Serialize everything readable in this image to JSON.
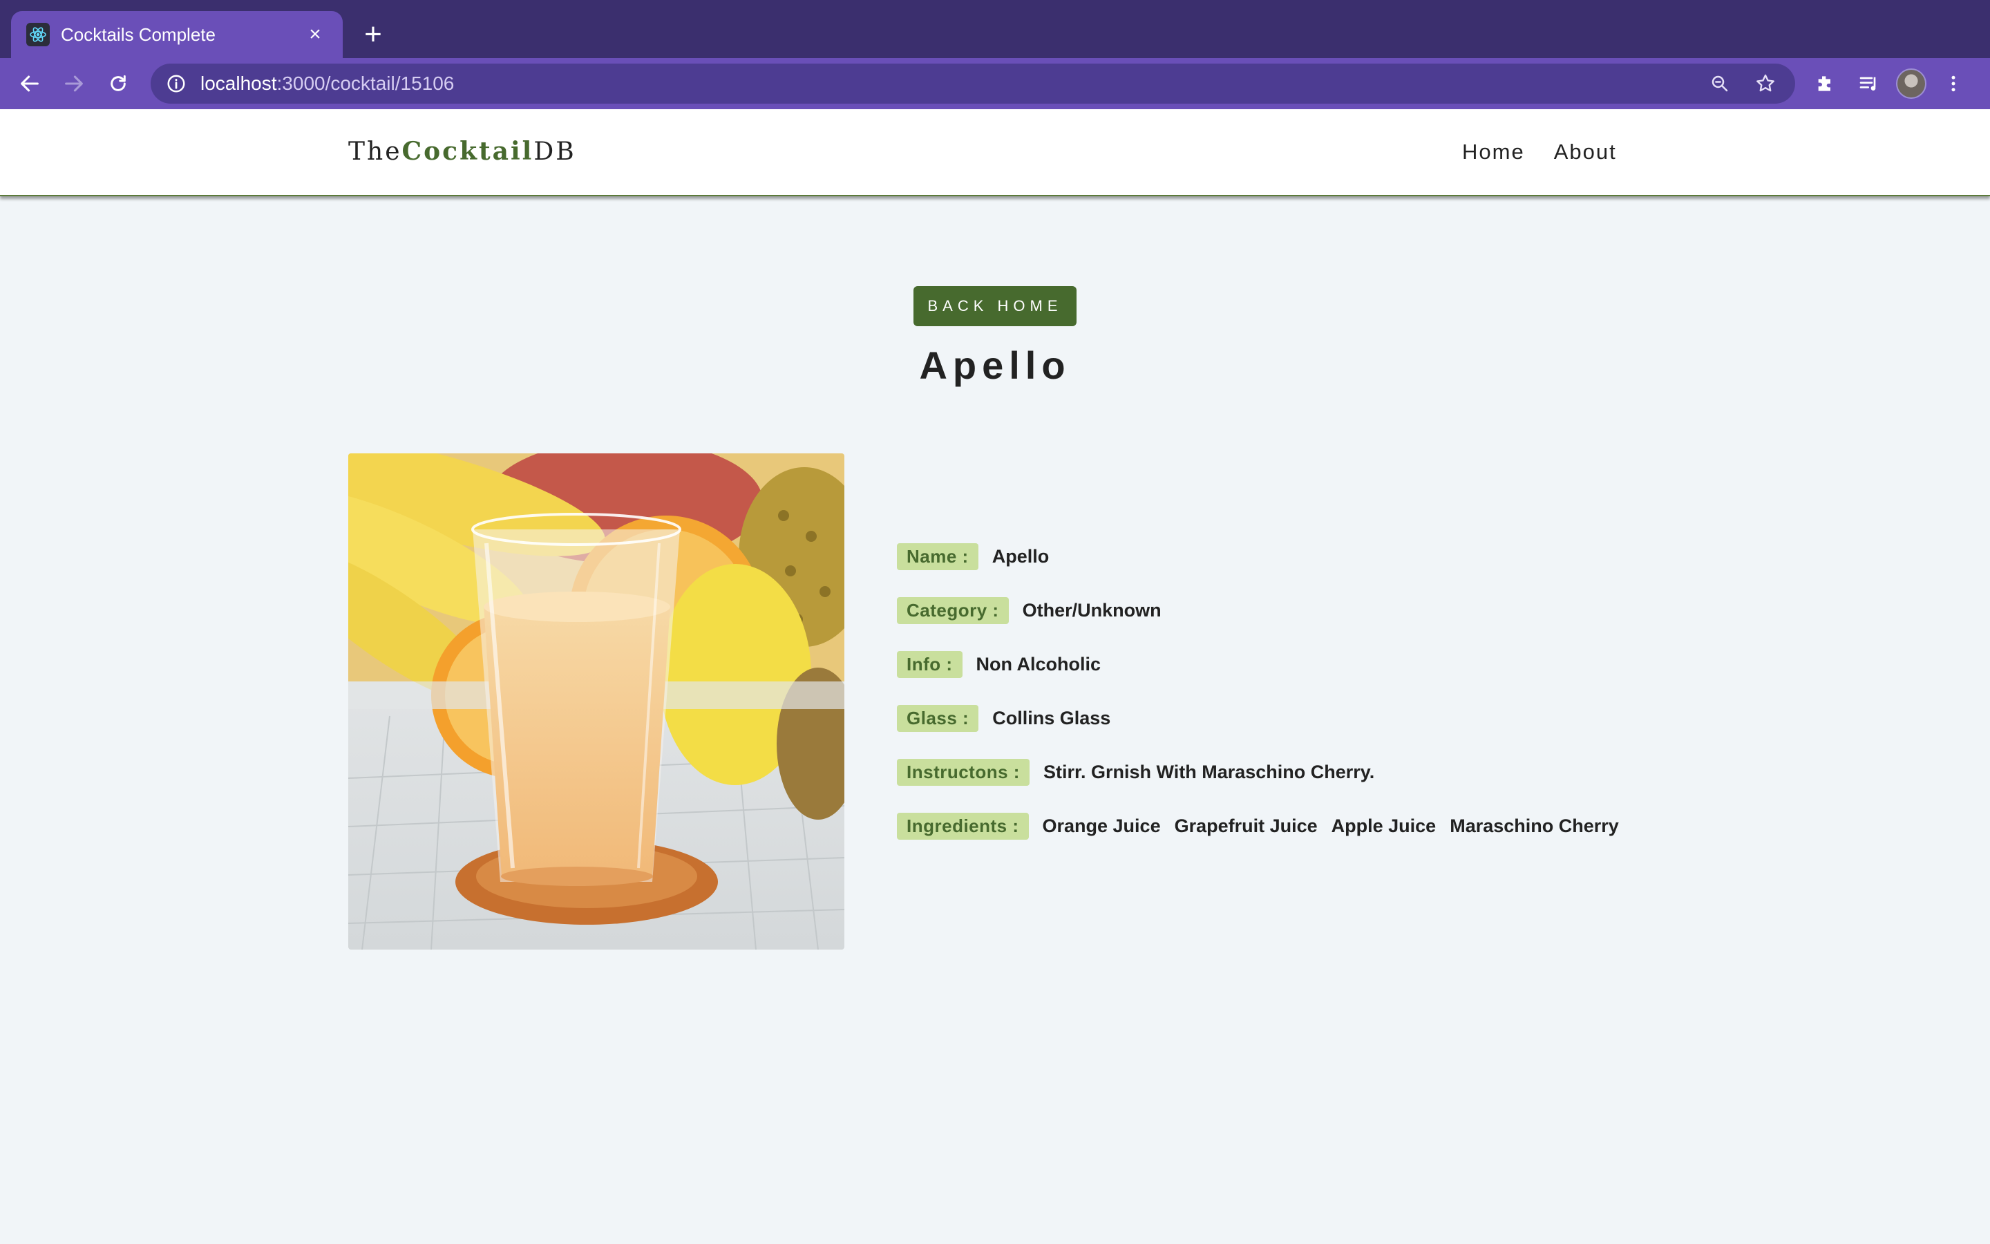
{
  "browser": {
    "tab_title": "Cocktails Complete",
    "tab_close": "×",
    "new_tab": "+",
    "url_host": "localhost",
    "url_path": ":3000/cocktail/15106"
  },
  "colors": {
    "chrome_bg": "#3b2f6e",
    "chrome_toolbar": "#6a4fb8",
    "accent_green": "#476a2e",
    "label_bg": "#c9df9d",
    "page_bg": "#f1f5f8"
  },
  "navbar": {
    "logo_prefix": "The",
    "logo_bold": "Cocktail",
    "logo_suffix": "DB",
    "links": [
      {
        "label": "Home"
      },
      {
        "label": "About"
      }
    ]
  },
  "main": {
    "back_button": "Back Home",
    "title": "Apello",
    "image_alt": "glass of orange fruit juice on coaster with bananas, oranges and pineapple",
    "info": {
      "name_label": "Name :",
      "name_value": "Apello",
      "category_label": "Category :",
      "category_value": "Other/Unknown",
      "alcoholic_label": "Info :",
      "alcoholic_value": "Non Alcoholic",
      "glass_label": "Glass :",
      "glass_value": "Collins Glass",
      "instructions_label": "Instructons :",
      "instructions_value": "Stirr. Grnish With Maraschino Cherry.",
      "ingredients_label": "Ingredients :",
      "ingredients": [
        "Orange Juice",
        "Grapefruit Juice",
        "Apple Juice",
        "Maraschino Cherry"
      ]
    }
  }
}
